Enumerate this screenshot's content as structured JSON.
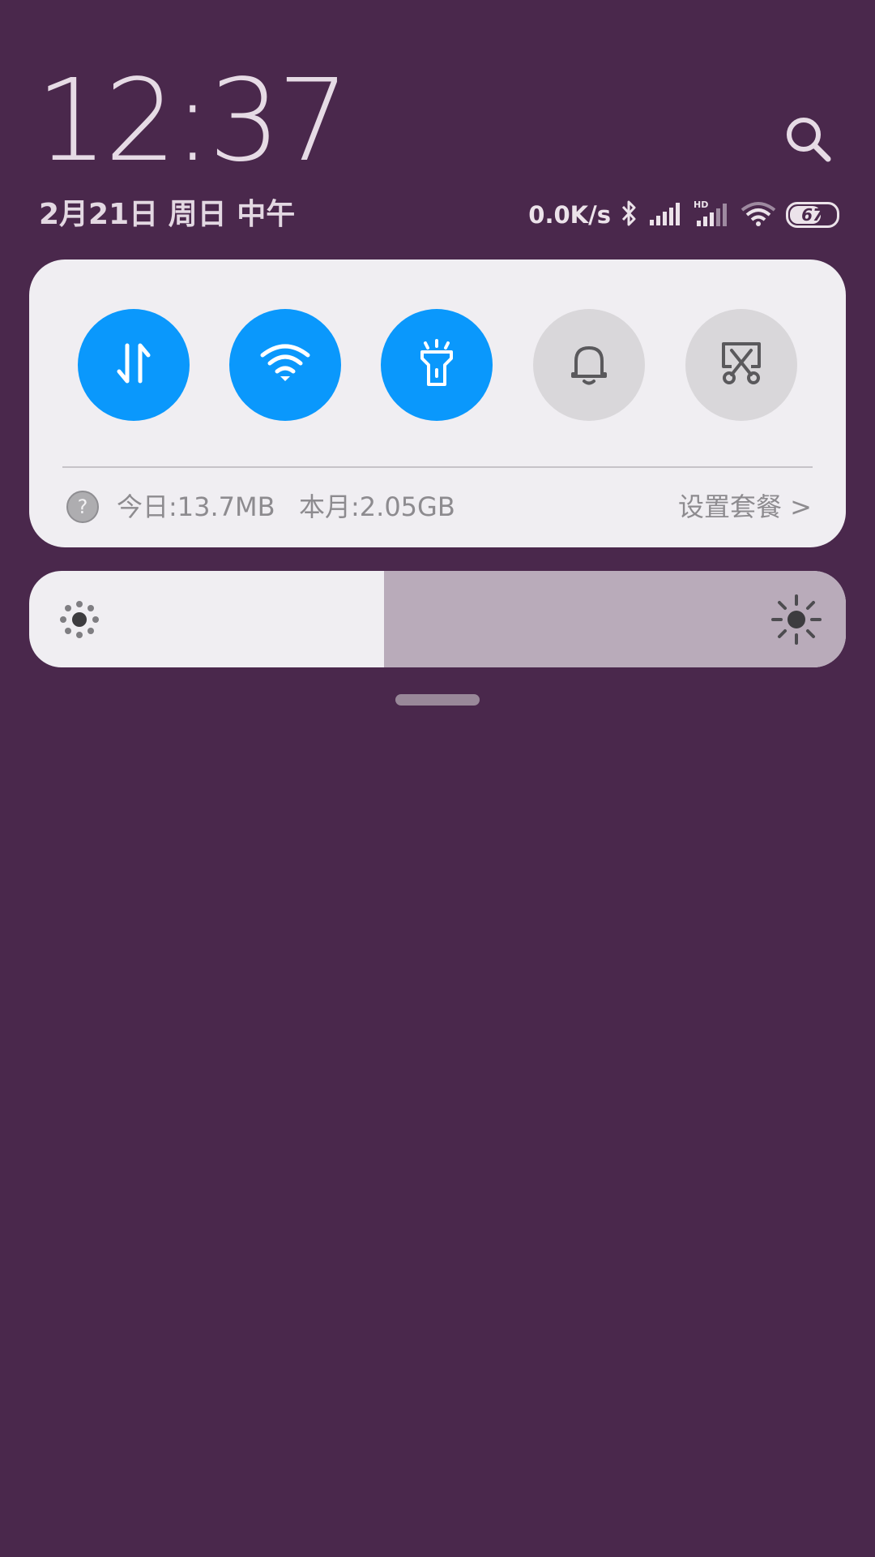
{
  "header": {
    "time": "12:37",
    "date": "2月21日 周日 中午"
  },
  "status_bar": {
    "net_speed": "0.0K/s",
    "icons": [
      "bluetooth-icon",
      "cell-signal-icon",
      "hd-cell-signal-icon",
      "wifi-signal-icon"
    ],
    "battery_level": "67",
    "battery_fraction": 0.67
  },
  "toggles": [
    {
      "name": "mobile-data",
      "icon": "data-transfer-icon",
      "state": "on"
    },
    {
      "name": "wifi",
      "icon": "wifi-icon",
      "state": "on"
    },
    {
      "name": "flashlight",
      "icon": "flashlight-icon",
      "state": "on"
    },
    {
      "name": "sound",
      "icon": "bell-icon",
      "state": "off"
    },
    {
      "name": "screenshot",
      "icon": "scissors-icon",
      "state": "off"
    }
  ],
  "data_usage": {
    "help": "?",
    "today": "今日:13.7MB",
    "month": "本月:2.05GB",
    "plan_link": "设置套餐 >"
  },
  "brightness": {
    "level": 0.435
  },
  "colors": {
    "background": "#4a284c",
    "panel": "#f0eef2",
    "toggle_on": "#0a98fc",
    "toggle_off": "#d9d7da",
    "brightness_track": "#b9abba"
  }
}
